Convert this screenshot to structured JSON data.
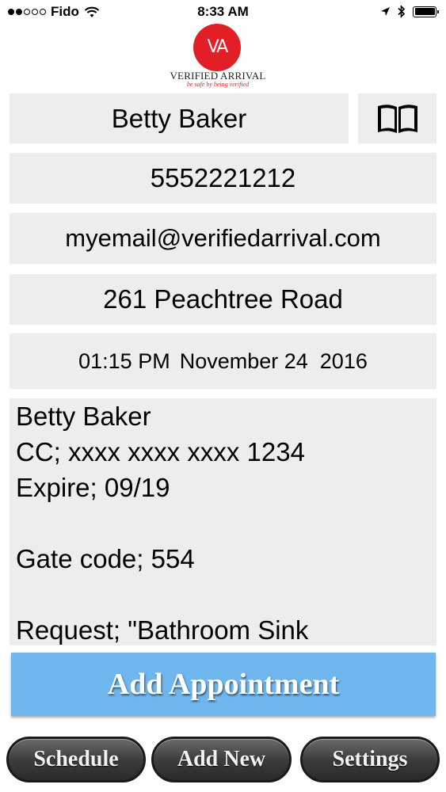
{
  "status_bar": {
    "carrier": "Fido",
    "time": "8:33 AM",
    "signal_bars_filled": 2,
    "signal_bars_total": 5,
    "icons": [
      "wifi-icon",
      "location-arrow-icon",
      "bluetooth-icon",
      "battery-icon"
    ]
  },
  "logo": {
    "mark": "VA",
    "name": "VERIFIED ARRIVAL",
    "tagline": "be safe by being verified",
    "color": "#e21f26"
  },
  "form": {
    "client_name": "Betty Baker",
    "contacts_icon": "open-book-icon",
    "phone": "5552221212",
    "email": "myemail@verifiedarrival.com",
    "address": "261 Peachtree Road",
    "time": "01:15 PM",
    "date": "November 24  2016",
    "notes_lines": [
      "Betty Baker",
      "CC; xxxx xxxx xxxx 1234",
      "Expire; 09/19",
      "",
      "Gate code; 554",
      "",
      "Request; \"Bathroom Sink"
    ]
  },
  "actions": {
    "add_appointment": "Add Appointment",
    "add_appointment_color": "#6fb6ee"
  },
  "tabs": {
    "schedule": "Schedule",
    "add_new": "Add New",
    "settings": "Settings"
  },
  "colors": {
    "field_background": "#eeedee",
    "tab_background": "#3d3d3d"
  }
}
